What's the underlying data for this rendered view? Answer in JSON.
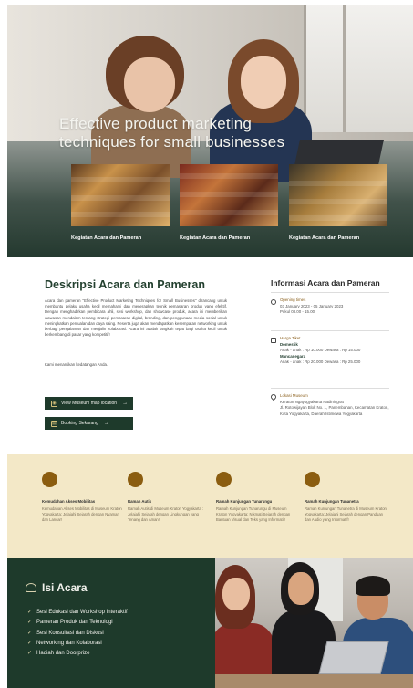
{
  "hero": {
    "title": "Effective product marketing techniques for small businesses",
    "cards": [
      {
        "label": "Kegiatan Acara dan Pameran"
      },
      {
        "label": "Kegiatan Acara dan Pameran"
      },
      {
        "label": "Kegiatan Acara dan Pameran"
      }
    ]
  },
  "description": {
    "title": "Deskripsi Acara dan Pameran",
    "paragraph": "Acara dan pameran \"Effective Product Marketing Techniques for Small Businesses\" dirancang untuk membantu pelaku usaha kecil memahami dan menerapkan teknik pemasaran produk yang efektif. Dengan menghadirkan pembicara ahli, sesi workshop, dan showcase produk, acara ini memberikan wawasan mendalam tentang strategi pemasaran digital, branding, dan penggunaan media sosial untuk meningkatkan penjualan dan daya saing. Peserta juga akan mendapatkan kesempatan networking untuk berbagi pengalaman dan menjalin kolaborasi. Acara ini adalah langkah tepat bagi usaha kecil untuk berkembang di pasar yang kompetitif!",
    "note": "Kami menantikan kedatangan Anda.",
    "map_button": "View Museum map location",
    "book_button": "Booking Sekarang"
  },
  "info": {
    "title": "Informasi Acara dan Pameran",
    "opening_label": "Opening times",
    "opening_dates": "03 January 2023 - 05 January 2023",
    "opening_hours": "Pukul 08.00 - 15.00",
    "ticket_label": "Harga Tiket",
    "domestic_label": "Domestik",
    "domestic_prices": "Anak - anak : Rp 10.000 Dewasa : Rp 15.000",
    "foreign_label": "Mancanegara",
    "foreign_prices": "Anak - anak : Rp 20.000 Dewasa : Rp 25.000",
    "location_label": "Lokasi Museum",
    "location_name": "Keraton Ngayogyakarta Hadiningrat",
    "location_address": "Jl. Rotowijayan Blok No. 1, Panembahan, Kecamatan Kraton, Kota Yogyakarta, Daerah Istimewa Yogyakarta"
  },
  "features": [
    {
      "title": "Kemudahan Akses Mobilitas",
      "text": "Kemudahan Akses Mobilitas di Museum Kraton Yogyakarta: Jelajahi Sejarah dengan Nyaman dan Lancar!"
    },
    {
      "title": "Ramah Autis",
      "text": "Ramah Autis di Museum Kraton Yogyakarta : Jelajahi Sejarah dengan Lingkungan yang Tenang dan Aman!"
    },
    {
      "title": "Ramah Kunjungan Tunarungu",
      "text": "Ramah Kunjungan Tunarungu di Museum Kraton Yogyakarta: Nikmati Sejarah dengan Bantuan Visual dan Teks yang Informatif!"
    },
    {
      "title": "Ramah Kunjungan Tunanetra",
      "text": "Ramah Kunjungan Tunanetra di Museum Kraton Yogyakarta: Jelajahi Sejarah dengan Panduan dan Audio yang Informatif!"
    }
  ],
  "isi": {
    "title": "Isi Acara",
    "items": [
      "Sesi Edukasi dan Workshop Interaktif",
      "Pameran Produk dan Teknologi",
      "Sesi Konsultasi dan Diskusi",
      "Networking dan Kolaborasi",
      "Hadiah dan Doorprize"
    ]
  },
  "colors": {
    "primary_green": "#1e3a2b",
    "accent_gold": "#8b5d10",
    "cream": "#f3e8c7"
  },
  "icons": [
    "clock-icon",
    "ticket-icon",
    "location-pin-icon",
    "map-icon",
    "booking-icon",
    "arrow-right-icon",
    "check-icon",
    "event-icon"
  ]
}
